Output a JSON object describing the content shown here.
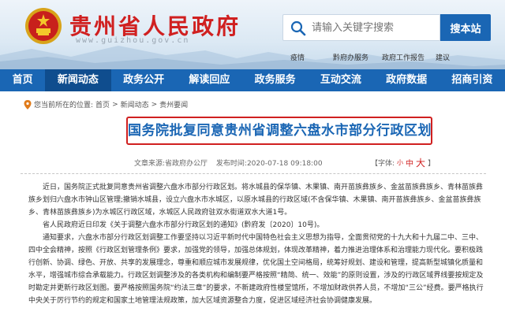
{
  "site": {
    "title": "贵州省人民政府",
    "url": "www.guizhou.gov.cn"
  },
  "search": {
    "placeholder": "请输入关键字搜索",
    "button_label": "搜本站"
  },
  "quicklinks": [
    "疫情",
    "黔府办服务",
    "政府工作报告",
    "建议"
  ],
  "nav": {
    "active_index": 1,
    "items": [
      "首页",
      "新闻动态",
      "政务公开",
      "解读回应",
      "政务服务",
      "互动交流",
      "政府数据",
      "招商引资"
    ]
  },
  "breadcrumb": {
    "prefix": "您当前所在的位置:",
    "items": [
      "首页",
      "新闻动态",
      "贵州要闻"
    ],
    "separator": ">"
  },
  "article": {
    "title": "国务院批复同意贵州省调整六盘水市部分行政区划",
    "source_label": "文章来源:省政府办公厅",
    "date_label": "发布时间:2020-07-18 09:18:00",
    "font_label": "【字体:",
    "font_small": "小",
    "font_mid": "中",
    "font_big": "大",
    "font_end": "】",
    "paragraphs": [
      "近日，国务院正式批复同意贵州省调整六盘水市部分行政区划。将水城县的保华镇、木果镇、南开苗族彝族乡、金盆苗族彝族乡、青林苗族彝族乡划归六盘水市钟山区管理;撤销水城县，设立六盘水市水城区，以原水城县的行政区域(不含保华镇、木果镇、南开苗族彝族乡、金盆苗族彝族乡、青林苗族彝族乡)为水城区行政区域，水城区人民政府驻双水街道双水大道1号。",
      "省人民政府近日印发《关于调整六盘水市部分行政区划的通知》(黔府发〔2020〕10号)。",
      "通知要求，六盘水市部分行政区划调整工作要坚持以习近平新时代中国特色社会主义思想为指导，全面贯彻党的十九大和十九届二中、三中、四中全会精神，按照《行政区划管理条例》要求，加强党的领导，加强总体规划，体现改革精神，着力推进治理体系和治理能力现代化。要积极践行创新、协调、绿色、开放、共享的发展理念，尊重和顺应城市发展规律，优化国土空间格局，统筹好规划、建设和管理，提高新型城镇化质量和水平，增强城市综合承载能力。行政区划调整涉及的各类机构和编制要严格按照“精简、统一、效能”的原则设置，涉及的行政区域界线要按规定及时勘定并更新行政区划图。要严格按照国务院“约法三章”的要求，不新建政府性楼堂馆所，不增加财政供养人员，不增加“三公”经费。要严格执行中央关于厉行节约的规定和国家土地管理法规政策，加大区域资源整合力度，促进区域经济社会协调健康发展。"
    ]
  }
}
